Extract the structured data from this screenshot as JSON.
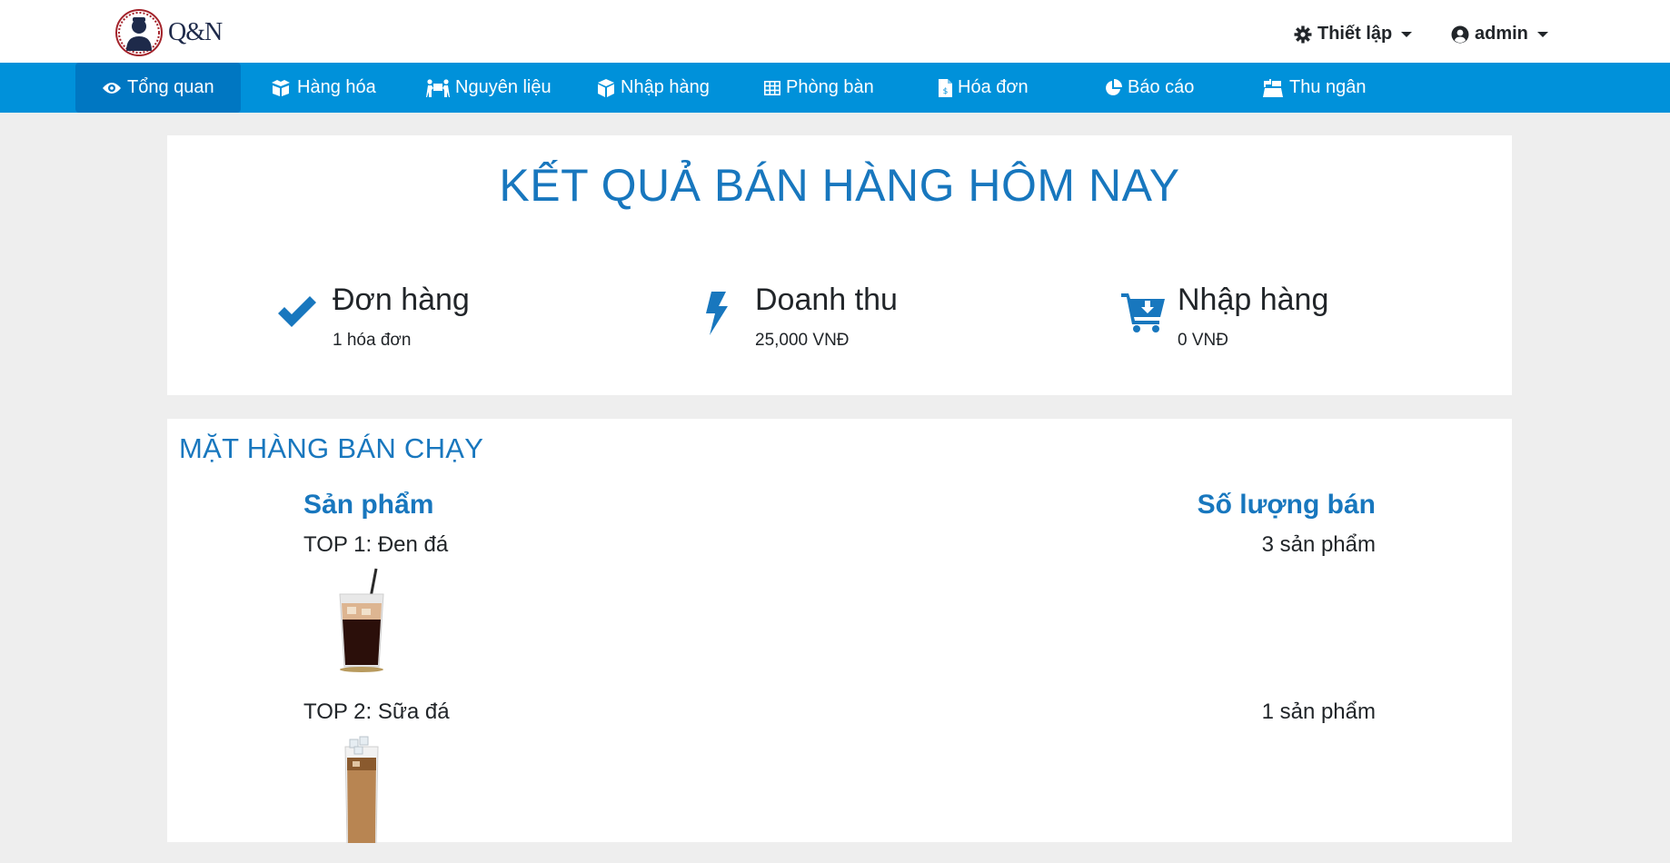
{
  "brand": {
    "logo_text": "Q&N"
  },
  "header": {
    "settings_label": "Thiết lập",
    "user_label": "admin"
  },
  "nav": {
    "items": [
      {
        "label": "Tổng quan",
        "icon": "eye-icon",
        "active": true
      },
      {
        "label": "Hàng hóa",
        "icon": "boxes-icon"
      },
      {
        "label": "Nguyên liệu",
        "icon": "people-carry-icon"
      },
      {
        "label": "Nhập hàng",
        "icon": "box-icon"
      },
      {
        "label": "Phòng bàn",
        "icon": "table-icon"
      },
      {
        "label": "Hóa đơn",
        "icon": "invoice-icon"
      },
      {
        "label": "Báo cáo",
        "icon": "chart-pie-icon"
      },
      {
        "label": "Thu ngân",
        "icon": "cash-register-icon"
      }
    ]
  },
  "summary": {
    "title": "KẾT QUẢ BÁN HÀNG HÔM NAY",
    "stats": [
      {
        "title": "Đơn hàng",
        "value": "1 hóa đơn",
        "icon": "check-icon"
      },
      {
        "title": "Doanh thu",
        "value": "25,000 VNĐ",
        "icon": "bolt-icon"
      },
      {
        "title": "Nhập hàng",
        "value": "0 VNĐ",
        "icon": "cart-download-icon"
      }
    ]
  },
  "best_sellers": {
    "title": "MẶT HÀNG BÁN CHẠY",
    "col_product": "Sản phẩm",
    "col_qty": "Số lượng bán",
    "rows": [
      {
        "name": "TOP 1: Đen đá",
        "qty": "3 sản phẩm",
        "image": "iced-black-coffee"
      },
      {
        "name": "TOP 2: Sữa đá",
        "qty": "1 sản phẩm",
        "image": "iced-milk-coffee"
      }
    ]
  },
  "colors": {
    "nav_bg": "#0091da",
    "nav_active_bg": "#0077c2",
    "accent_blue": "#1877be",
    "page_bg": "#eeeeee"
  }
}
